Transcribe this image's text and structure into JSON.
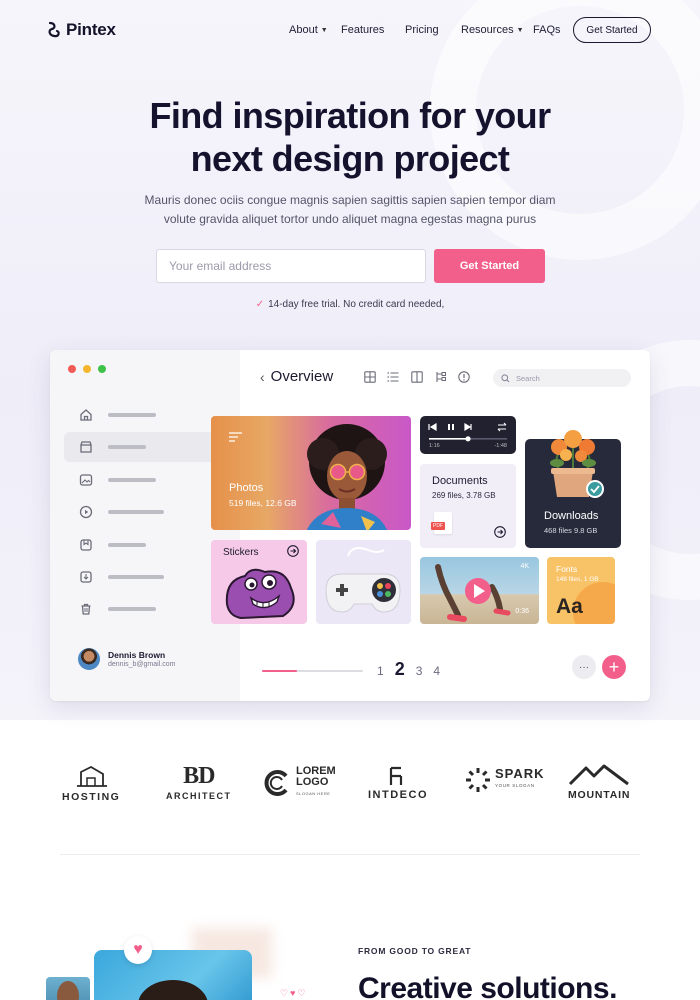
{
  "nav": {
    "brand": "Pintex",
    "items": [
      {
        "label": "About",
        "dropdown": true
      },
      {
        "label": "Features",
        "dropdown": false
      },
      {
        "label": "Pricing",
        "dropdown": false
      },
      {
        "label": "Resources",
        "dropdown": true
      },
      {
        "label": "FAQs",
        "dropdown": false
      }
    ],
    "cta": "Get Started"
  },
  "hero": {
    "title_line1": "Find inspiration for your",
    "title_line2": "next design project",
    "subtitle_line1": "Mauris donec ociis congue magnis sapien sagittis sapien sapien tempor diam",
    "subtitle_line2": "volute gravida aliquet tortor undo aliquet magna egestas magna purus",
    "email_placeholder": "Your email address",
    "cta": "Get Started",
    "trial_note": "14-day free trial. No credit card needed,"
  },
  "app_mockup": {
    "title": "Overview",
    "search_placeholder": "Search",
    "user": {
      "name": "Dennis Brown",
      "email": "dennis_b@gmail.com"
    },
    "cards": {
      "photos": {
        "label": "Photos",
        "meta": "519 files, 12.6 GB"
      },
      "player": {
        "elapsed": "1:16",
        "total": "-1:48",
        "progress": 0.5
      },
      "documents": {
        "label": "Documents",
        "meta": "269 files, 3.78 GB",
        "file_type": "PDF"
      },
      "downloads": {
        "label": "Downloads",
        "meta": "468 files 9.8 GB"
      },
      "stickers": {
        "label": "Stickers"
      },
      "video": {
        "quality": "4K",
        "duration": "0:36"
      },
      "fonts": {
        "label": "Fonts",
        "meta": "148 files, 1 GB",
        "sample": "Aa"
      }
    },
    "pagination": {
      "pages": [
        "1",
        "2",
        "3",
        "4"
      ],
      "current": "2",
      "progress": 0.35
    },
    "more_label": "···",
    "add_label": "+"
  },
  "logos": [
    {
      "name": "HOSTING"
    },
    {
      "name": "ARCHITECT",
      "mark": "BD"
    },
    {
      "name": "LOREM LOGO",
      "line1": "LOREM",
      "line2": "LOGO",
      "tagline": "SLOGAN HERE"
    },
    {
      "name": "INTDECO"
    },
    {
      "name": "SPARK",
      "tagline": "YOUR SLOGAN"
    },
    {
      "name": "MOUNTAIN"
    }
  ],
  "section2": {
    "eyebrow": "FROM GOOD TO GREAT",
    "headline": "Creative solutions."
  },
  "colors": {
    "accent": "#f25f8a",
    "dark": "#14132b",
    "hero_bg": "#efedf8"
  }
}
